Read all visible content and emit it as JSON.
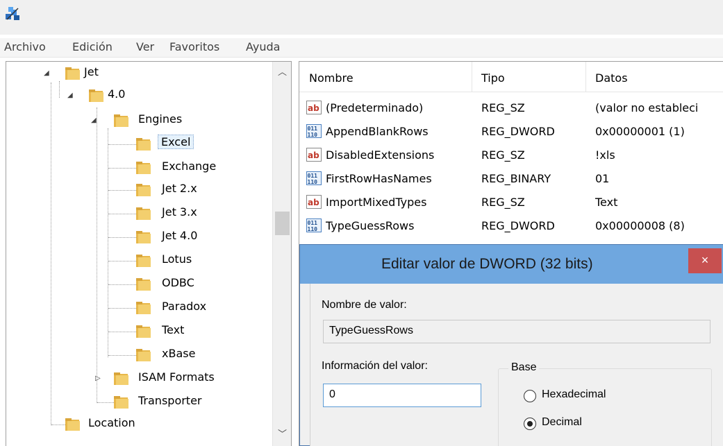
{
  "menubar": {
    "items": [
      "Archivo",
      "Edición",
      "Ver",
      "Favoritos",
      "Ayuda"
    ]
  },
  "tree": {
    "items": [
      {
        "label": "Jet",
        "expanded": true
      },
      {
        "label": "4.0",
        "expanded": true
      },
      {
        "label": "Engines",
        "expanded": true
      },
      {
        "label": "Excel",
        "selected": true
      },
      {
        "label": "Exchange"
      },
      {
        "label": "Jet 2.x"
      },
      {
        "label": "Jet 3.x"
      },
      {
        "label": "Jet 4.0"
      },
      {
        "label": "Lotus"
      },
      {
        "label": "ODBC"
      },
      {
        "label": "Paradox"
      },
      {
        "label": "Text"
      },
      {
        "label": "xBase"
      },
      {
        "label": "ISAM Formats",
        "expanded": false
      },
      {
        "label": "Transporter"
      },
      {
        "label": "Location"
      }
    ]
  },
  "list": {
    "headers": {
      "name": "Nombre",
      "type": "Tipo",
      "data": "Datos"
    },
    "rows": [
      {
        "icon": "string-value-icon",
        "name": "(Predeterminado)",
        "type": "REG_SZ",
        "data": "(valor no estableci"
      },
      {
        "icon": "binary-value-icon",
        "name": "AppendBlankRows",
        "type": "REG_DWORD",
        "data": "0x00000001 (1)"
      },
      {
        "icon": "string-value-icon",
        "name": "DisabledExtensions",
        "type": "REG_SZ",
        "data": "!xls"
      },
      {
        "icon": "binary-value-icon",
        "name": "FirstRowHasNames",
        "type": "REG_BINARY",
        "data": "01"
      },
      {
        "icon": "string-value-icon",
        "name": "ImportMixedTypes",
        "type": "REG_SZ",
        "data": "Text"
      },
      {
        "icon": "binary-value-icon",
        "name": "TypeGuessRows",
        "type": "REG_DWORD",
        "data": "0x00000008 (8)"
      }
    ]
  },
  "dialog": {
    "title": "Editar valor de DWORD (32 bits)",
    "close_label": "×",
    "name_label": "Nombre de valor:",
    "name_value": "TypeGuessRows",
    "data_label": "Información del valor:",
    "data_value": "0",
    "base_label": "Base",
    "hex_label": "Hexadecimal",
    "dec_label": "Decimal",
    "selected_base": "Decimal"
  },
  "colors": {
    "dialog_title": "#6fa7df",
    "close_button": "#c75050",
    "folder": "#e8b84a",
    "selection": "#e5f1fb"
  }
}
